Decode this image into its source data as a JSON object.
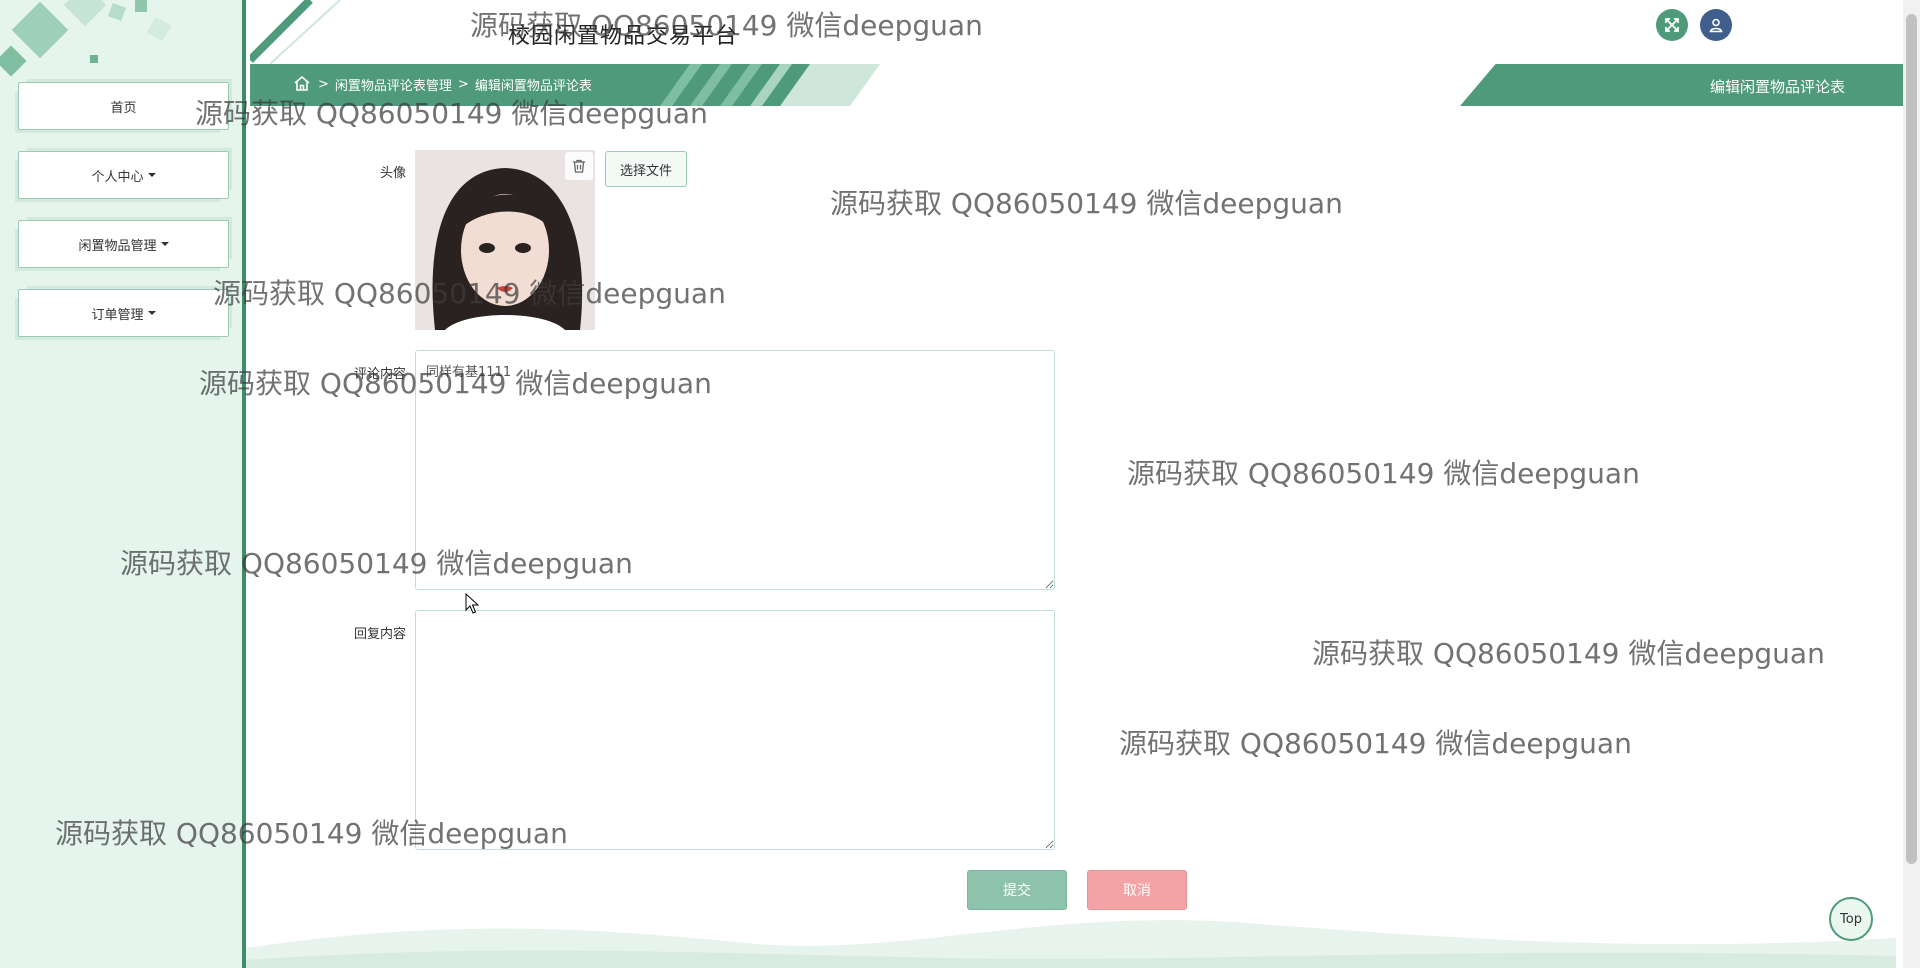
{
  "header": {
    "title": "校园闲置物品交易平台",
    "expand_icon": "expand-icon",
    "user_icon": "user-icon"
  },
  "sidebar": {
    "items": [
      {
        "label": "首页",
        "has_dropdown": false
      },
      {
        "label": "个人中心",
        "has_dropdown": true
      },
      {
        "label": "闲置物品管理",
        "has_dropdown": true
      },
      {
        "label": "订单管理",
        "has_dropdown": true
      }
    ]
  },
  "breadcrumb": {
    "separator": ">",
    "items": [
      "闲置物品评论表管理",
      "编辑闲置物品评论表"
    ]
  },
  "page_title": "编辑闲置物品评论表",
  "form": {
    "avatar_label": "头像",
    "file_button_label": "选择文件",
    "comment_label": "评论内容",
    "comment_value": "同样有基1111",
    "reply_label": "回复内容",
    "reply_value": "",
    "submit_label": "提交",
    "cancel_label": "取消"
  },
  "top_button_label": "Top",
  "watermark_text": "源码获取 QQ86050149 微信deepguan",
  "colors": {
    "primary": "#4e9a7a",
    "sidebar_bg": "#e6f4ee",
    "submit": "#8dc3ac",
    "cancel": "#f3a3a3",
    "user_icon_bg": "#3f5e8c"
  }
}
